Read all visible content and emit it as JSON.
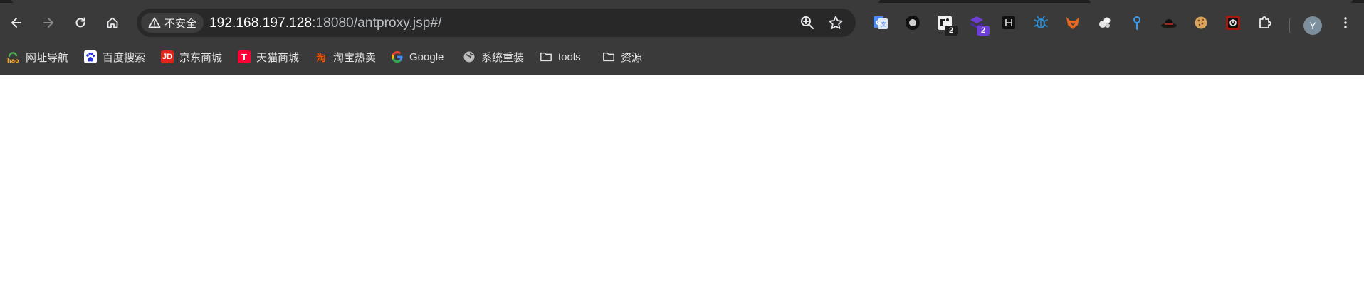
{
  "window": {
    "security_label": "不安全",
    "url_host": "192.168.197.128",
    "url_path": ":18080/antproxy.jsp#/"
  },
  "extensions": [
    {
      "name": "google-translate-icon",
      "badge": ""
    },
    {
      "name": "record-icon",
      "badge": ""
    },
    {
      "name": "tag-assistant-icon",
      "badge": "2"
    },
    {
      "name": "wappalyzer-icon",
      "badge": "2"
    },
    {
      "name": "hackbar-icon",
      "badge": ""
    },
    {
      "name": "bug-icon",
      "badge": ""
    },
    {
      "name": "foxyproxy-icon",
      "badge": ""
    },
    {
      "name": "cookie-cluster-icon",
      "badge": ""
    },
    {
      "name": "location-pin-icon",
      "badge": ""
    },
    {
      "name": "hat-icon",
      "badge": ""
    },
    {
      "name": "cookie-icon",
      "badge": ""
    },
    {
      "name": "record-box-icon",
      "badge": ""
    },
    {
      "name": "puzzle-piece-icon",
      "badge": ""
    }
  ],
  "profile": {
    "initial": "Y"
  },
  "bookmarks": [
    {
      "label": "网址导航",
      "icon": "hao123-icon"
    },
    {
      "label": "百度搜索",
      "icon": "baidu-icon"
    },
    {
      "label": "京东商城",
      "icon": "jd-icon",
      "icon_text": "JD"
    },
    {
      "label": "天猫商城",
      "icon": "tmall-icon",
      "icon_text": "T"
    },
    {
      "label": "淘宝热卖",
      "icon": "taobao-icon",
      "icon_text": "淘"
    },
    {
      "label": "Google",
      "icon": "google-icon"
    },
    {
      "label": "系统重装",
      "icon": "globe-icon"
    },
    {
      "label": "tools",
      "icon": "folder-icon"
    },
    {
      "label": "资源",
      "icon": "folder-icon"
    }
  ],
  "colors": {
    "toolbar_bg": "#3a3a3a",
    "omnibox_bg": "#282828",
    "page_bg": "#ffffff"
  }
}
